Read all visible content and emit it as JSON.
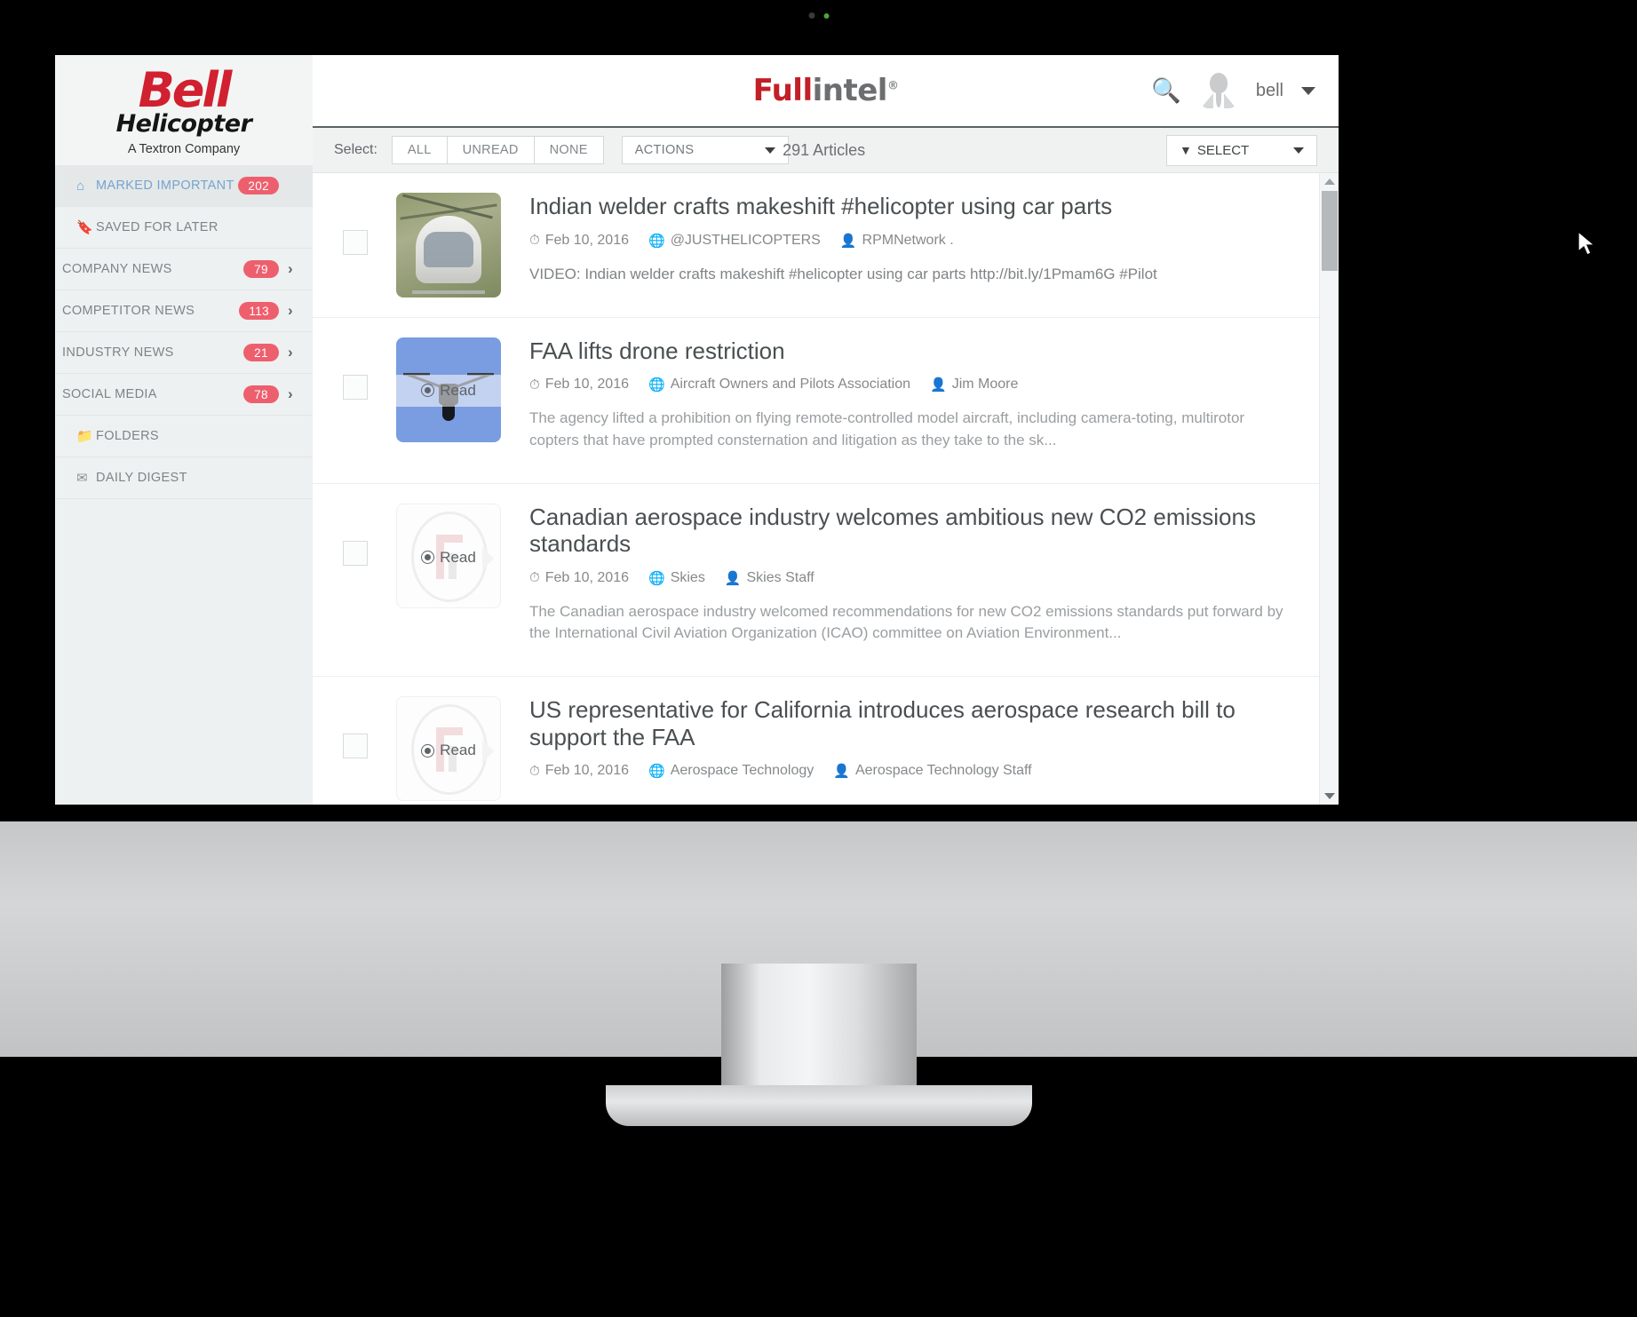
{
  "brand": {
    "part1": "Full",
    "part2": "intel",
    "mark": "®"
  },
  "sidebar": {
    "logo": {
      "word": "Bell",
      "sub": "Helicopter",
      "tagline": "A Textron Company"
    },
    "items": [
      {
        "label": "MARKED IMPORTANT",
        "badge": "202",
        "icon": "home-icon",
        "active": true,
        "chevron": false
      },
      {
        "label": "SAVED FOR LATER",
        "badge": "",
        "icon": "bookmark-icon",
        "active": false,
        "chevron": false
      },
      {
        "label": "COMPANY NEWS",
        "badge": "79",
        "icon": "",
        "active": false,
        "chevron": true
      },
      {
        "label": "COMPETITOR NEWS",
        "badge": "113",
        "icon": "",
        "active": false,
        "chevron": true
      },
      {
        "label": "INDUSTRY NEWS",
        "badge": "21",
        "icon": "",
        "active": false,
        "chevron": true
      },
      {
        "label": "SOCIAL MEDIA",
        "badge": "78",
        "icon": "",
        "active": false,
        "chevron": true
      },
      {
        "label": "FOLDERS",
        "badge": "",
        "icon": "folder-icon",
        "active": false,
        "chevron": false
      },
      {
        "label": "DAILY DIGEST",
        "badge": "",
        "icon": "envelope-icon",
        "active": false,
        "chevron": false
      }
    ]
  },
  "header": {
    "search_icon": "search-icon",
    "avatar_icon": "user-avatar-icon",
    "username": "bell",
    "caret_icon": "chevron-down-icon"
  },
  "toolbar": {
    "select_label": "Select:",
    "buttons": [
      "ALL",
      "UNREAD",
      "NONE"
    ],
    "actions_label": "ACTIONS",
    "article_count": "291 Articles",
    "filter_label": "SELECT",
    "filter_icon": "funnel-icon"
  },
  "articles": [
    {
      "title": "Indian welder crafts makeshift #helicopter using car parts",
      "date": "Feb 10, 2016",
      "source": "@JUSTHELICOPTERS",
      "author": "RPMNetwork .",
      "summary": "VIDEO: Indian welder crafts makeshift #helicopter using car parts http://bit.ly/1Pmam6G #Pilot",
      "thumb": "helicopter-photo",
      "read_label": "",
      "read_visible": false
    },
    {
      "title": "FAA lifts drone restriction",
      "date": "Feb 10, 2016",
      "source": "Aircraft Owners and Pilots Association",
      "author": "Jim Moore",
      "summary": "The agency lifted a prohibition on flying remote-controlled model aircraft, including camera-toting, multirotor copters that have prompted consternation and litigation as they take to the sk...",
      "thumb": "drone-photo",
      "read_label": "Read",
      "read_visible": true
    },
    {
      "title": "Canadian aerospace industry welcomes ambitious new CO2 emissions standards",
      "date": "Feb 10, 2016",
      "source": "Skies",
      "author": "Skies Staff",
      "summary": "The Canadian aerospace industry welcomed recommendations for new CO2 emissions standards put forward by the International Civil Aviation Organization (ICAO) committee on Aviation Environment...",
      "thumb": "fullintel-placeholder",
      "read_label": "Read",
      "read_visible": true
    },
    {
      "title": "US representative for California introduces aerospace research bill to support the FAA",
      "date": "Feb 10, 2016",
      "source": "Aerospace Technology",
      "author": "Aerospace Technology Staff",
      "summary": "",
      "thumb": "fullintel-placeholder",
      "read_label": "Read",
      "read_visible": true
    }
  ],
  "colors": {
    "badge_red": "#ee5f6e",
    "brand_red": "#c21f28",
    "logo_red": "#d1202f",
    "active_blue": "#76a4cf"
  }
}
